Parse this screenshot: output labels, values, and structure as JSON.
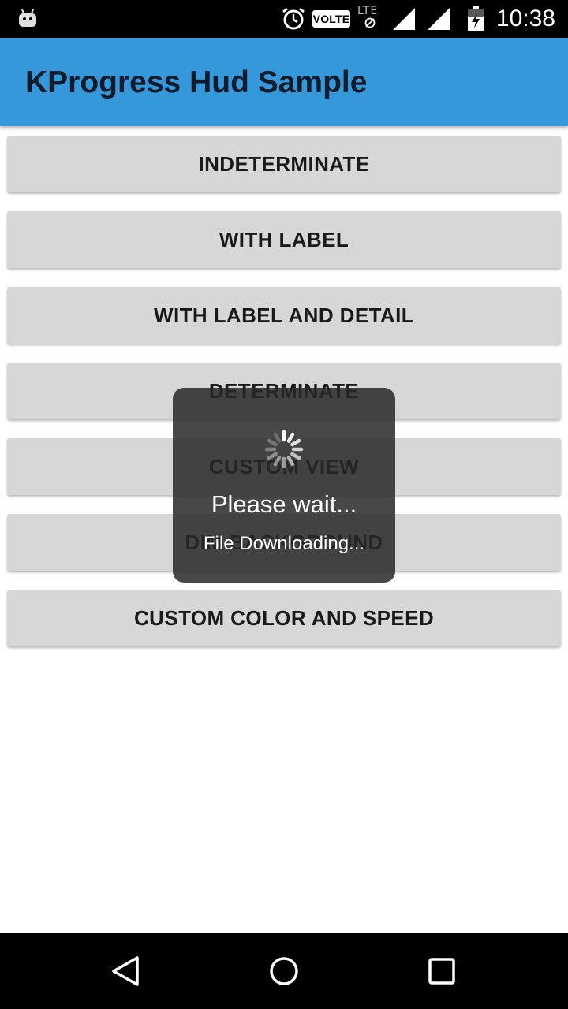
{
  "status_bar": {
    "time": "10:38",
    "volte_label": "VOLTE",
    "lte_label": "LTE",
    "icons": [
      "android-icon",
      "alarm-icon",
      "lte-slash-icon",
      "signal-icon",
      "signal-icon",
      "battery-icon"
    ]
  },
  "app_bar": {
    "title": "KProgress Hud Sample",
    "color": "#3498db"
  },
  "buttons": [
    {
      "label": "INDETERMINATE"
    },
    {
      "label": "WITH LABEL"
    },
    {
      "label": "WITH LABEL AND DETAIL"
    },
    {
      "label": "DETERMINATE"
    },
    {
      "label": "CUSTOM VIEW"
    },
    {
      "label": "DIM BACKGROUND"
    },
    {
      "label": "CUSTOM COLOR AND SPEED"
    }
  ],
  "hud": {
    "label": "Please wait...",
    "detail": "File Downloading...",
    "icon": "spinner-icon"
  },
  "nav_bar": {
    "icons": [
      "back-icon",
      "home-icon",
      "recents-icon"
    ]
  }
}
